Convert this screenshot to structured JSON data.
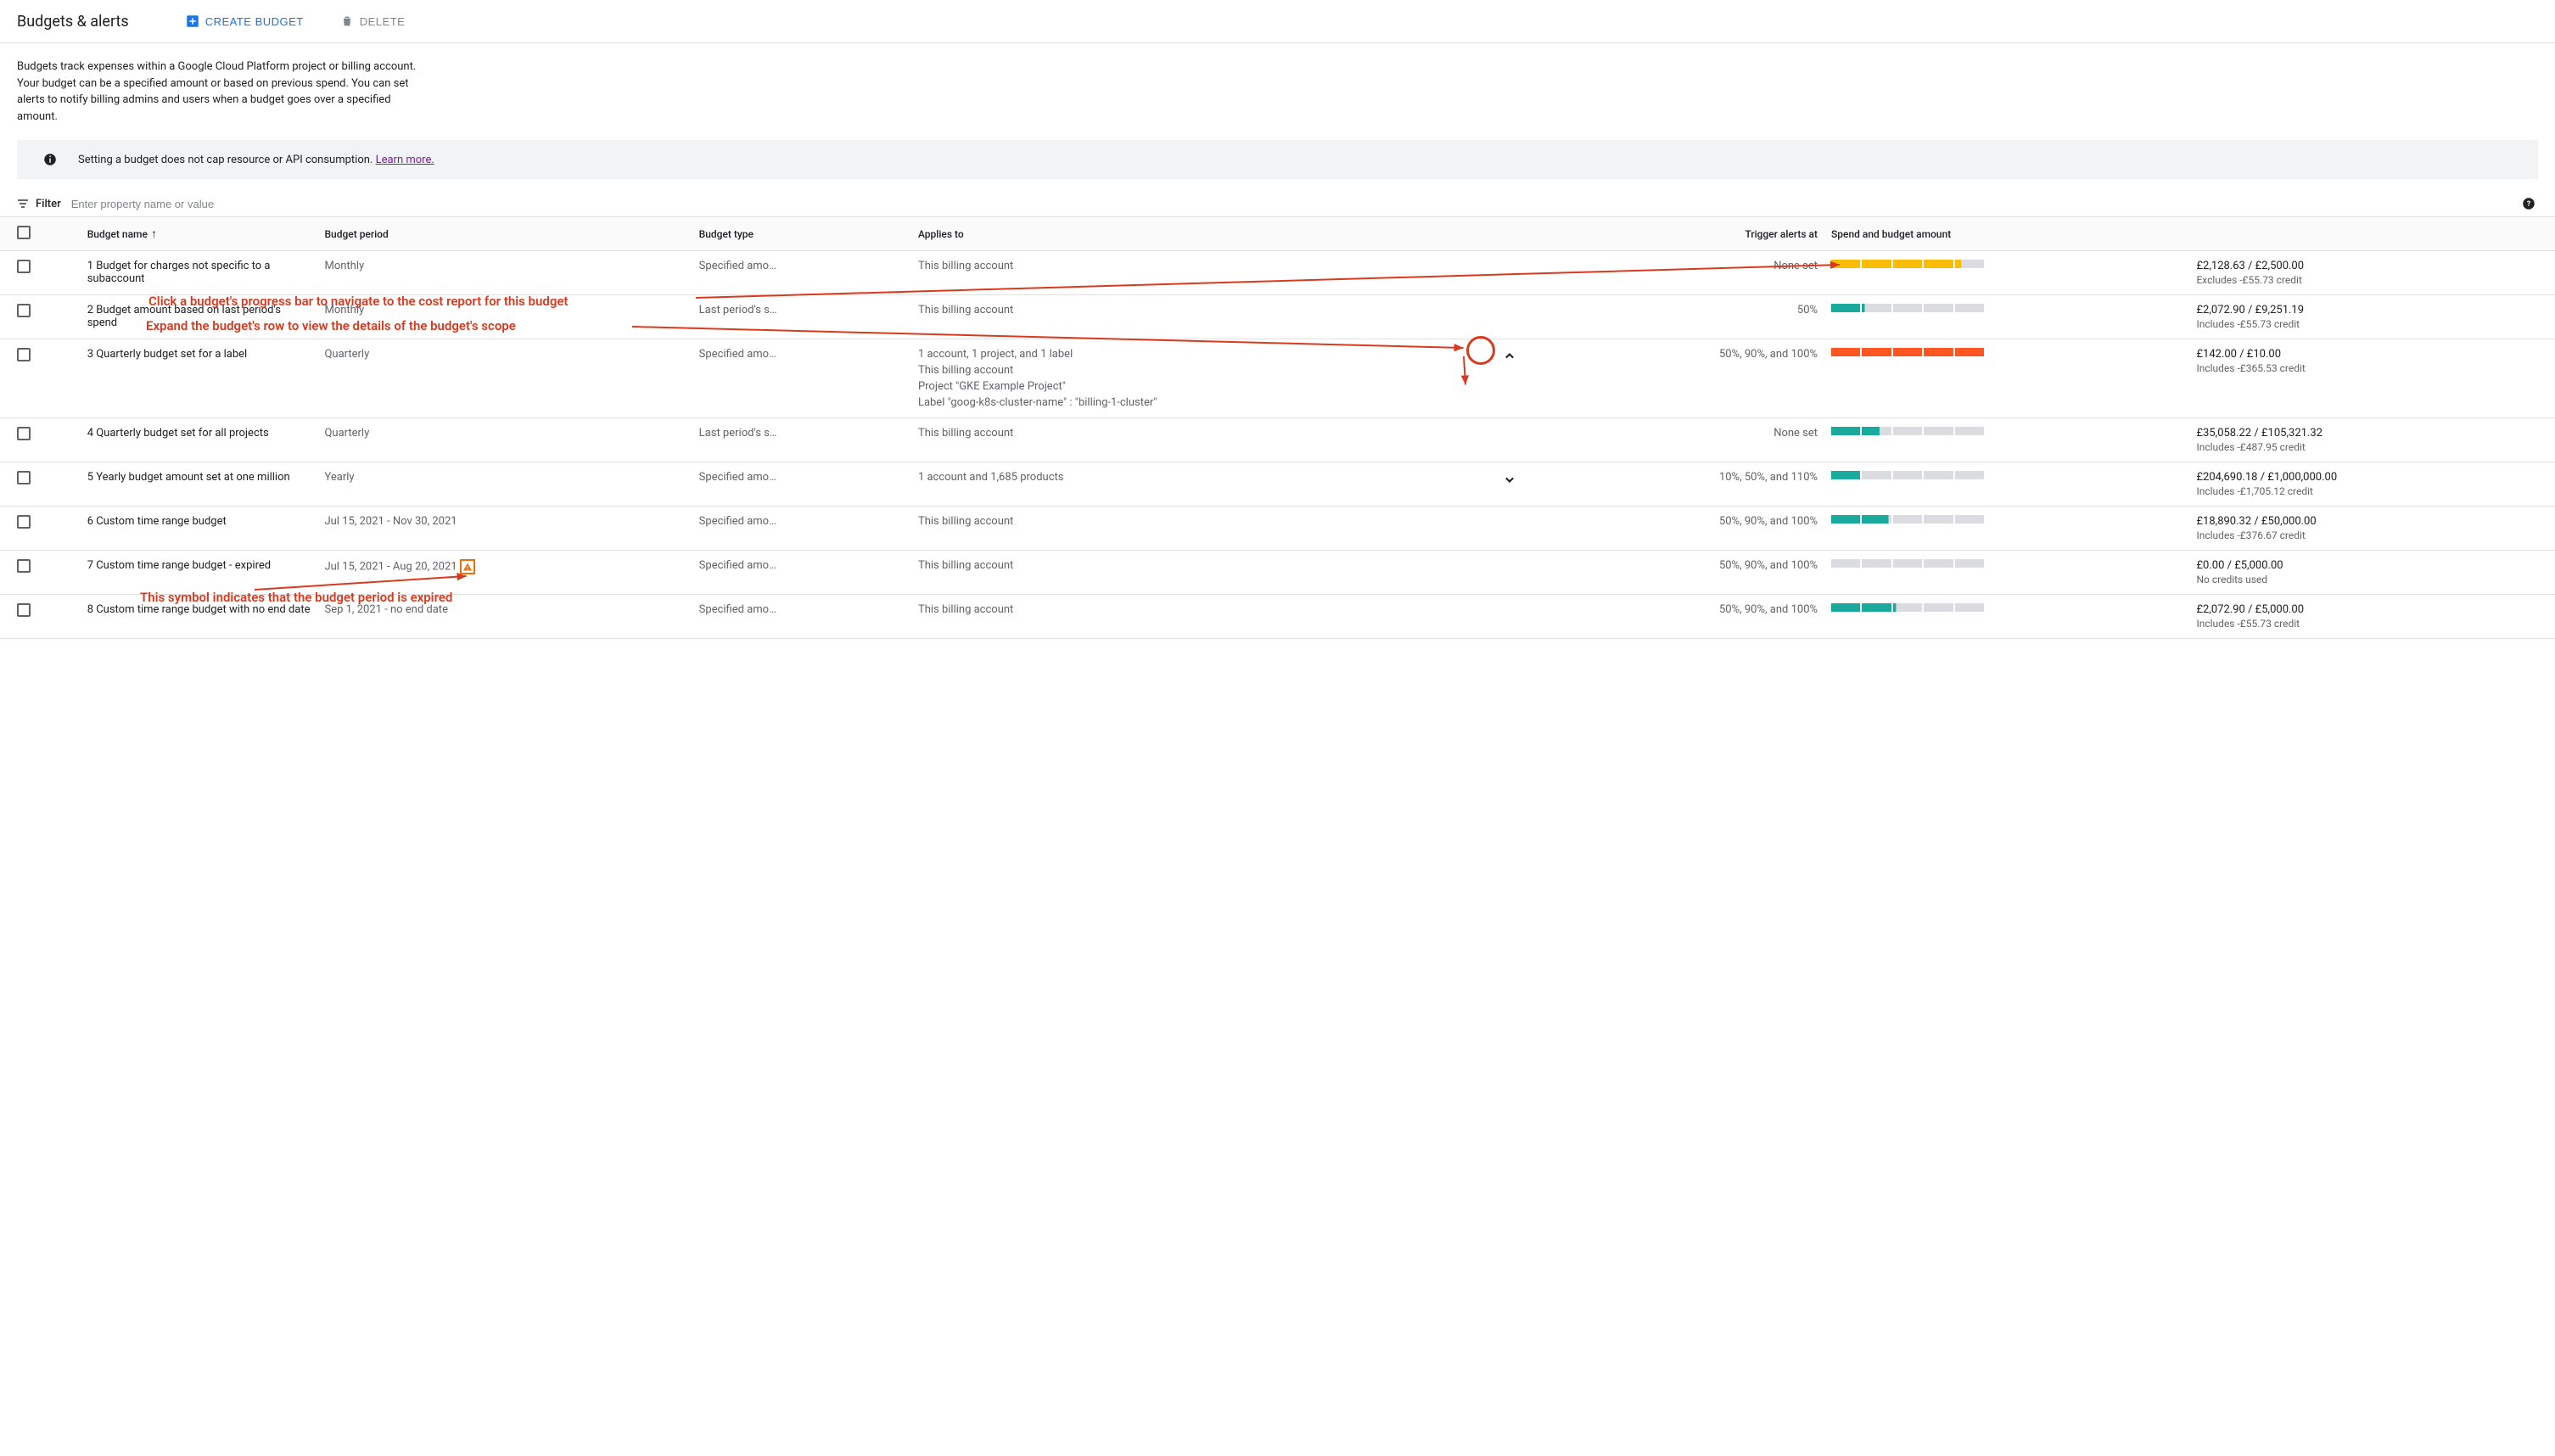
{
  "header": {
    "title": "Budgets & alerts",
    "create_label": "CREATE BUDGET",
    "delete_label": "DELETE"
  },
  "description": "Budgets track expenses within a Google Cloud Platform project or billing account. Your budget can be a specified amount or based on previous spend. You can set alerts to notify billing admins and users when a budget goes over a specified amount.",
  "banner": {
    "text": "Setting a budget does not cap resource or API consumption. ",
    "link": "Learn more."
  },
  "filter": {
    "label": "Filter",
    "placeholder": "Enter property name or value"
  },
  "columns": {
    "name": "Budget name",
    "period": "Budget period",
    "type": "Budget type",
    "applies": "Applies to",
    "trigger": "Trigger alerts at",
    "spend": "Spend and budget amount"
  },
  "rows": [
    {
      "name": "1 Budget for charges not specific to a subaccount",
      "period": "Monthly",
      "type": "Specified amo…",
      "applies": "This billing account",
      "chev": "",
      "trigger": "None set",
      "bar_color": "#fbbc04",
      "bar_segments": 4.2,
      "amount": "£2,128.63 / £2,500.00",
      "sub": "Excludes -£55.73 credit"
    },
    {
      "name": "2 Budget amount based on last period's spend",
      "period": "Monthly",
      "type": "Last period's s…",
      "applies": "This billing account",
      "chev": "",
      "trigger": "50%",
      "bar_color": "#1aa99d",
      "bar_segments": 1.1,
      "amount": "£2,072.90 / £9,251.19",
      "sub": "Includes -£55.73 credit"
    },
    {
      "name": "3 Quarterly budget set for a label",
      "period": "Quarterly",
      "type": "Specified amo…",
      "applies": "1 account, 1 project, and 1 label",
      "applies_extra": [
        "This billing account",
        "Project \"GKE Example Project\"",
        "Label \"goog-k8s-cluster-name\" : \"billing-1-cluster\""
      ],
      "chev": "up",
      "trigger": "50%, 90%, and 100%",
      "bar_color": "#ff5722",
      "bar_segments": 5,
      "amount": "£142.00 / £10.00",
      "sub": "Includes -£365.53 credit"
    },
    {
      "name": "4 Quarterly budget set for all projects",
      "period": "Quarterly",
      "type": "Last period's s…",
      "applies": "This billing account",
      "chev": "",
      "trigger": "None set",
      "bar_color": "#1aa99d",
      "bar_segments": 1.6,
      "amount": "£35,058.22 / £105,321.32",
      "sub": "Includes -£487.95 credit"
    },
    {
      "name": "5 Yearly budget amount set at one million",
      "period": "Yearly",
      "type": "Specified amo…",
      "applies": "1 account and 1,685 products",
      "chev": "down",
      "trigger": "10%, 50%, and 110%",
      "bar_color": "#1aa99d",
      "bar_segments": 1,
      "amount": "£204,690.18 / £1,000,000.00",
      "sub": "Includes -£1,705.12 credit"
    },
    {
      "name": "6 Custom time range budget",
      "period": "Jul 15, 2021 - Nov 30, 2021",
      "type": "Specified amo…",
      "applies": "This billing account",
      "chev": "",
      "trigger": "50%, 90%, and 100%",
      "bar_color": "#1aa99d",
      "bar_segments": 1.9,
      "amount": "£18,890.32 / £50,000.00",
      "sub": "Includes -£376.67 credit"
    },
    {
      "name": "7 Custom time range budget - expired",
      "period": "Jul 15, 2021 - Aug 20, 2021",
      "period_warn": true,
      "type": "Specified amo…",
      "applies": "This billing account",
      "chev": "",
      "trigger": "50%, 90%, and 100%",
      "bar_color": "#dadce0",
      "bar_segments": 0,
      "amount": "£0.00 / £5,000.00",
      "sub": "No credits used"
    },
    {
      "name": "8 Custom time range budget with no end date",
      "period": "Sep 1, 2021 - no end date",
      "type": "Specified amo…",
      "applies": "This billing account",
      "chev": "",
      "trigger": "50%, 90%, and 100%",
      "bar_color": "#1aa99d",
      "bar_segments": 2.1,
      "amount": "£2,072.90 / £5,000.00",
      "sub": "Includes -£55.73 credit"
    }
  ],
  "annotations": {
    "a1": "Click a budget's progress bar to navigate to the cost report for this budget",
    "a2": "Expand the budget's row to view the details of the budget's scope",
    "a3": "This symbol indicates that the budget period is expired"
  }
}
